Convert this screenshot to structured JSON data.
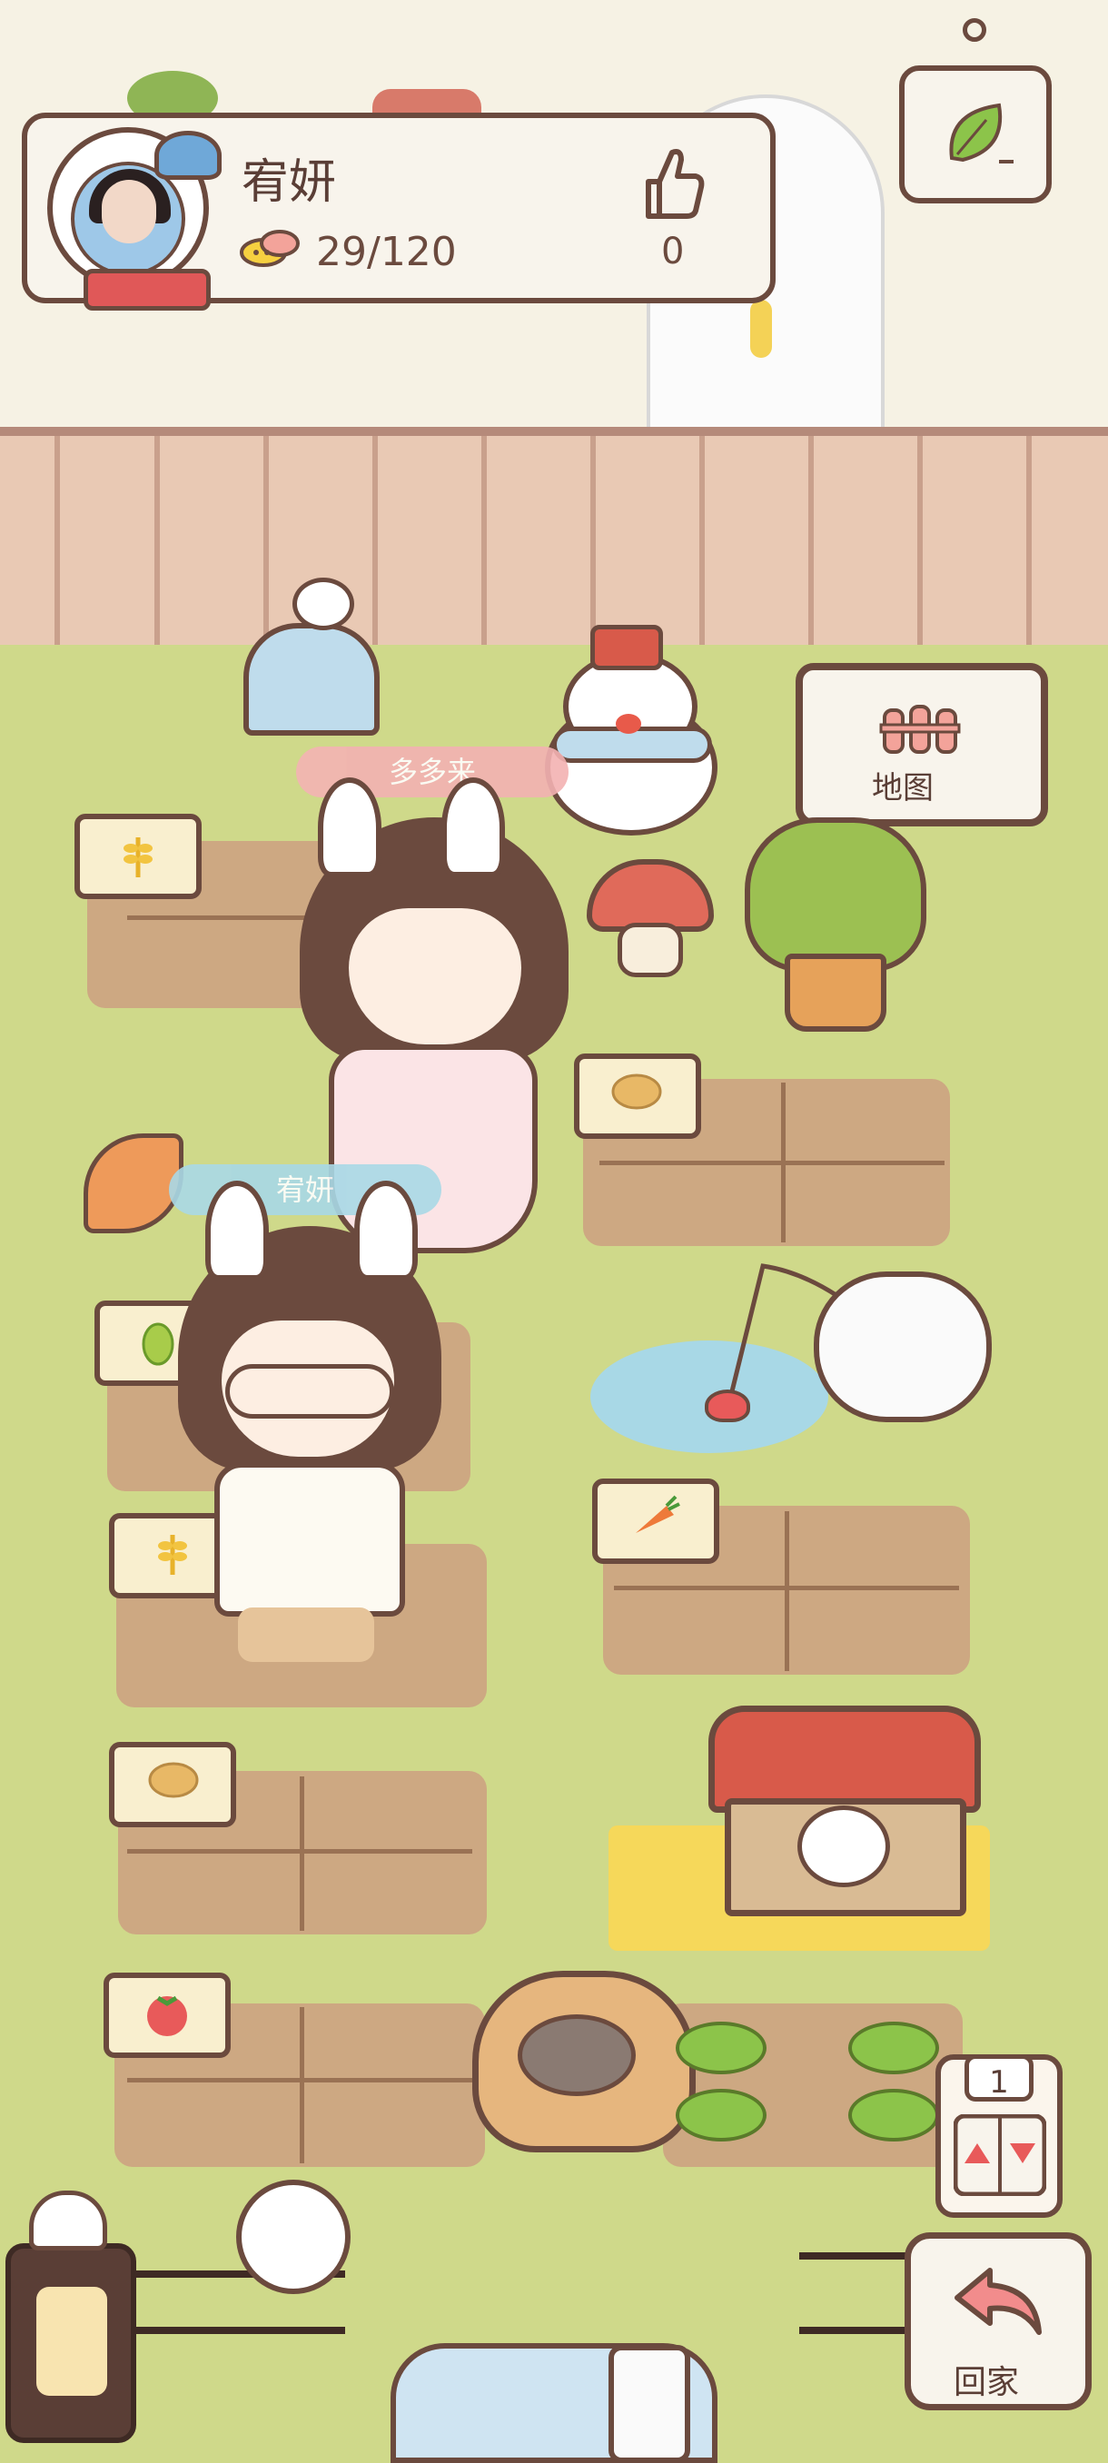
{
  "profile": {
    "name": "宥妍",
    "energy": "29/120",
    "energy_icon": "energy-creature-icon",
    "like_icon": "thumbs-up-icon",
    "like_count": "0"
  },
  "characters": {
    "visitor_name": "多多来",
    "player_name": "宥妍"
  },
  "map_button": {
    "label": "地图",
    "icon": "map-gate-icon"
  },
  "floor_selector": {
    "floor": "1",
    "up_icon": "triangle-up-icon",
    "down_icon": "triangle-down-icon"
  },
  "home_button": {
    "label": "回家",
    "icon": "return-arrow-icon"
  },
  "frame_icon": "leaf-icon",
  "colors": {
    "outline": "#6b4a3e",
    "grass": "#cfd98a",
    "fence": "#e9c9b4",
    "soil": "#cda882",
    "accent_pink": "#f28c8c"
  }
}
